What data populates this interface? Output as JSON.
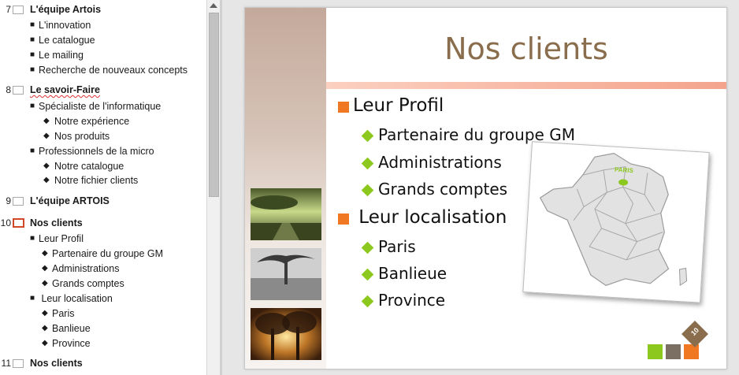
{
  "outline": {
    "slides": [
      {
        "number": "7",
        "title": "L'équipe Artois",
        "items": [
          {
            "level": 1,
            "bullet": "■",
            "text": "L'innovation"
          },
          {
            "level": 1,
            "bullet": "■",
            "text": "Le catalogue"
          },
          {
            "level": 1,
            "bullet": "■",
            "text": "Le mailing"
          },
          {
            "level": 1,
            "bullet": "■",
            "text": "Recherche de nouveaux concepts"
          }
        ]
      },
      {
        "number": "8",
        "title": "Le savoir-Faire",
        "items": [
          {
            "level": 1,
            "bullet": "■",
            "text": "Spécialiste de l'informatique"
          },
          {
            "level": 2,
            "bullet": "◆",
            "text": "Notre expérience"
          },
          {
            "level": 2,
            "bullet": "◆",
            "text": "Nos produits"
          },
          {
            "level": 1,
            "bullet": "■",
            "text": "Professionnels de la micro"
          },
          {
            "level": 2,
            "bullet": "◆",
            "text": "Notre catalogue"
          },
          {
            "level": 2,
            "bullet": "◆",
            "text": "Notre fichier clients"
          }
        ]
      },
      {
        "number": "9",
        "title": "L'équipe ARTOIS",
        "items": []
      },
      {
        "number": "10",
        "title": "Nos clients",
        "selected": true,
        "items": [
          {
            "level": 1,
            "bullet": "■",
            "text": "Leur Profil"
          },
          {
            "level": 2,
            "bullet": "◆",
            "text": "Partenaire du groupe GM"
          },
          {
            "level": 2,
            "bullet": "◆",
            "text": "Administrations"
          },
          {
            "level": 2,
            "bullet": "◆",
            "text": "Grands comptes"
          },
          {
            "level": 1,
            "bullet": "■",
            "text": " Leur localisation"
          },
          {
            "level": 2,
            "bullet": "◆",
            "text": "Paris"
          },
          {
            "level": 2,
            "bullet": "◆",
            "text": "Banlieue"
          },
          {
            "level": 2,
            "bullet": "◆",
            "text": "Province"
          }
        ]
      },
      {
        "number": "11",
        "title": "Nos clients",
        "items": []
      }
    ]
  },
  "slide": {
    "title": "Nos clients",
    "sections": [
      {
        "heading": "Leur Profil",
        "items": [
          "Partenaire du groupe GM",
          "Administrations",
          "Grands comptes"
        ]
      },
      {
        "heading": " Leur localisation",
        "items": [
          "Paris",
          "Banlieue",
          "Province"
        ]
      }
    ],
    "map_label": "PARIS",
    "slide_number": "10"
  },
  "colors": {
    "accent_orange": "#f07823",
    "accent_green": "#8cc81e",
    "title_brown": "#8a6d4c",
    "selected_slide_border": "#d24726",
    "deco_gray": "#7a6f62"
  },
  "icons": {
    "bullet_level1": "square-bullet-icon",
    "bullet_level2": "diamond-bullet-icon",
    "scroll_up": "scroll-up-arrow-icon"
  }
}
